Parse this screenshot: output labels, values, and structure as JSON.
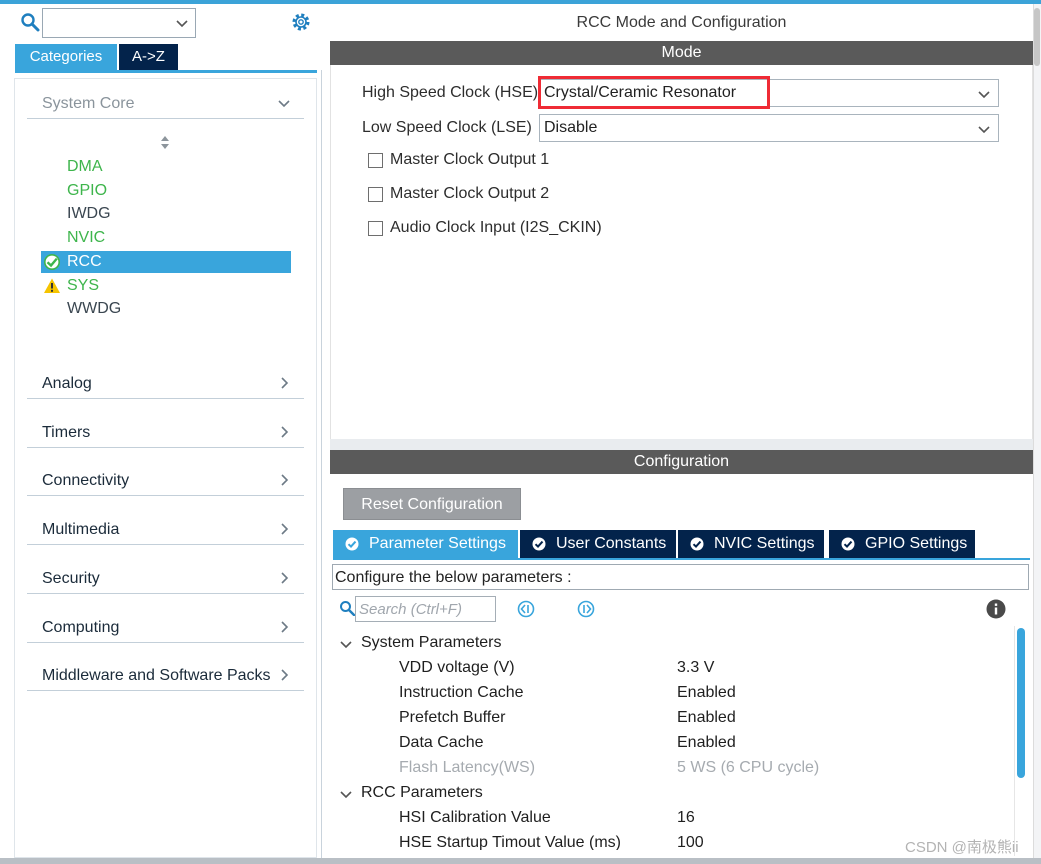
{
  "left_panel": {
    "search_value": "",
    "tabs": {
      "categories": "Categories",
      "az": "A->Z"
    },
    "system_core": {
      "label": "System Core",
      "items": [
        {
          "label": "DMA",
          "status": "green"
        },
        {
          "label": "GPIO",
          "status": "green"
        },
        {
          "label": "IWDG",
          "status": "gray"
        },
        {
          "label": "NVIC",
          "status": "green"
        },
        {
          "label": "RCC",
          "status": "selected-ok"
        },
        {
          "label": "SYS",
          "status": "warning"
        },
        {
          "label": "WWDG",
          "status": "gray"
        }
      ]
    },
    "categories": [
      "Analog",
      "Timers",
      "Connectivity",
      "Multimedia",
      "Security",
      "Computing",
      "Middleware and Software Packs"
    ]
  },
  "right_panel": {
    "title": "RCC Mode and Configuration",
    "mode": {
      "header": "Mode",
      "hse_label": "High Speed Clock (HSE)",
      "hse_value": "Crystal/Ceramic Resonator",
      "lse_label": "Low Speed Clock (LSE)",
      "lse_value": "Disable",
      "checkboxes": [
        {
          "label": "Master Clock Output 1",
          "checked": false
        },
        {
          "label": "Master Clock Output 2",
          "checked": false
        },
        {
          "label": "Audio Clock Input (I2S_CKIN)",
          "checked": false
        }
      ]
    },
    "configuration": {
      "header": "Configuration",
      "reset_label": "Reset Configuration",
      "tabs": [
        {
          "label": "Parameter Settings",
          "active": true
        },
        {
          "label": "User Constants",
          "active": false
        },
        {
          "label": "NVIC Settings",
          "active": false
        },
        {
          "label": "GPIO Settings",
          "active": false
        }
      ],
      "configure_text": "Configure the below parameters :",
      "search_placeholder": "Search (Ctrl+F)",
      "groups": [
        {
          "name": "System Parameters",
          "params": [
            {
              "name": "VDD voltage (V)",
              "value": "3.3 V",
              "disabled": false
            },
            {
              "name": "Instruction Cache",
              "value": "Enabled",
              "disabled": false
            },
            {
              "name": "Prefetch Buffer",
              "value": "Enabled",
              "disabled": false
            },
            {
              "name": "Data Cache",
              "value": "Enabled",
              "disabled": false
            },
            {
              "name": "Flash Latency(WS)",
              "value": "5 WS (6 CPU cycle)",
              "disabled": true
            }
          ]
        },
        {
          "name": "RCC Parameters",
          "params": [
            {
              "name": "HSI Calibration Value",
              "value": "16",
              "disabled": false
            },
            {
              "name": "HSE Startup Timout Value (ms)",
              "value": "100",
              "disabled": false
            }
          ]
        }
      ]
    }
  },
  "watermark": "CSDN @南极熊ii",
  "colors": {
    "accent_blue": "#39a5dc",
    "navy": "#03234b",
    "header_gray": "#5a5a5a",
    "green_text": "#3eb54c",
    "highlight_red": "#ef2b35"
  }
}
